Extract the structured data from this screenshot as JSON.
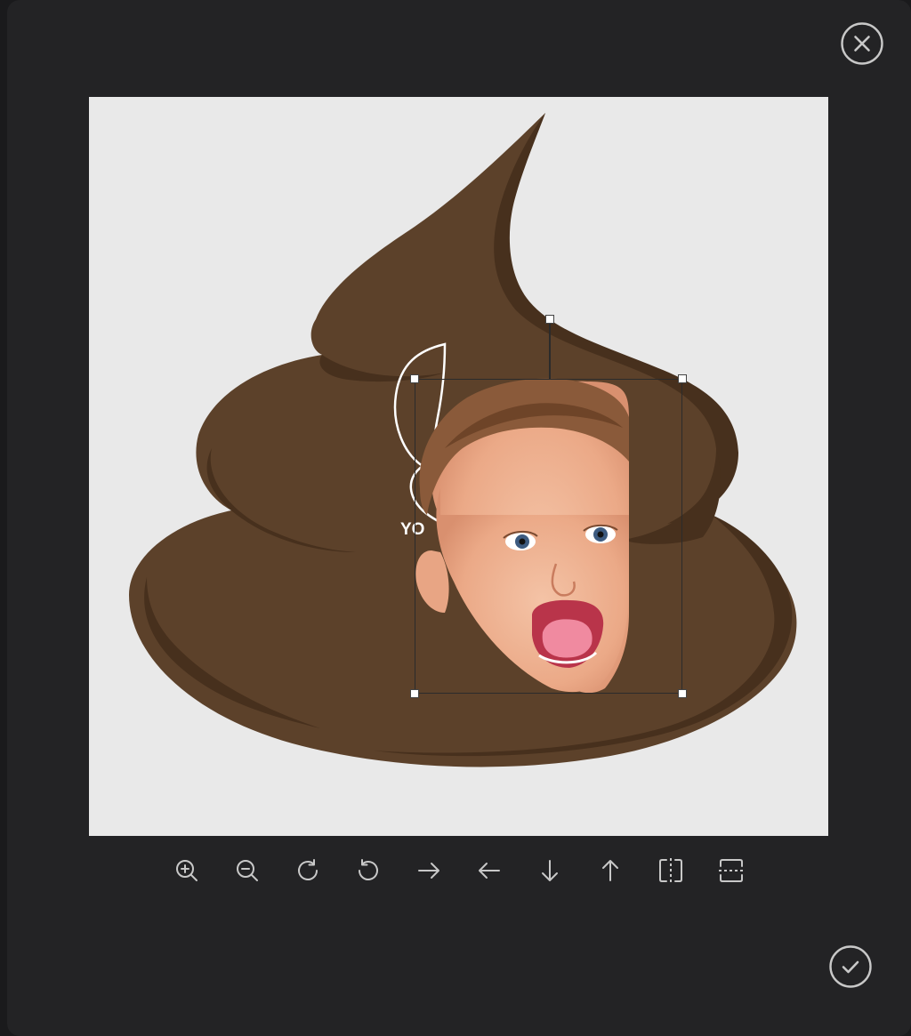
{
  "dialog": {
    "close_icon": "close-circle-icon",
    "confirm_icon": "check-circle-icon"
  },
  "canvas": {
    "background_color": "#e9e9e9",
    "sticker_text": "YO",
    "poop_colors": {
      "base": "#5c412a",
      "shadow": "#47301d"
    }
  },
  "toolbar": {
    "tools": [
      {
        "name": "zoom-in-icon"
      },
      {
        "name": "zoom-out-icon"
      },
      {
        "name": "rotate-right-icon"
      },
      {
        "name": "rotate-left-icon"
      },
      {
        "name": "arrow-right-icon"
      },
      {
        "name": "arrow-left-icon"
      },
      {
        "name": "arrow-down-icon"
      },
      {
        "name": "arrow-up-icon"
      },
      {
        "name": "flip-horizontal-icon"
      },
      {
        "name": "flip-vertical-icon"
      }
    ]
  },
  "theme": {
    "modal_bg": "#232325",
    "icon_color": "#c8c8c8"
  }
}
